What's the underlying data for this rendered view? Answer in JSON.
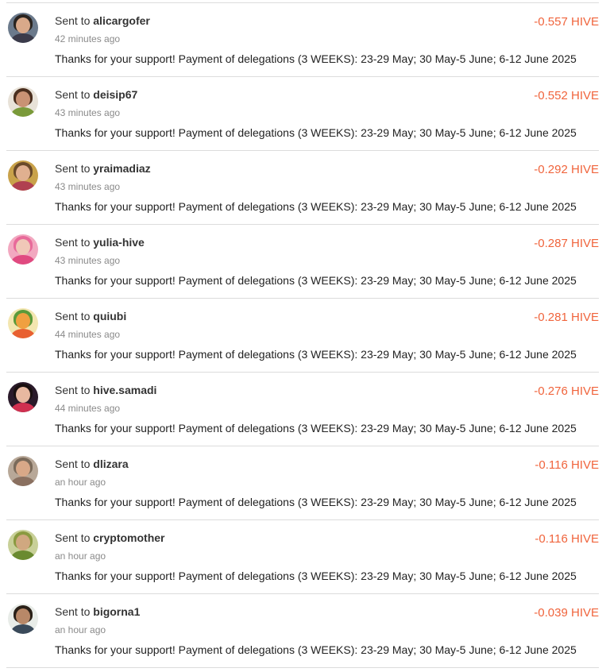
{
  "accent_color": "#f0643c",
  "transfers": [
    {
      "prefix": "Sent to ",
      "user": "alicargofer",
      "time": "42 minutes ago",
      "amount": "-0.557 HIVE",
      "memo": "Thanks for your support! Payment of delegations (3 WEEKS): 23-29 May; 30 May-5 June; 6-12 June 2025",
      "avatar_colors": {
        "bg": "#6b7a8c",
        "hair": "#2a2420",
        "face": "#d9a98a",
        "body": "#3b3b4a"
      }
    },
    {
      "prefix": "Sent to ",
      "user": "deisip67",
      "time": "43 minutes ago",
      "amount": "-0.552 HIVE",
      "memo": "Thanks for your support! Payment of delegations (3 WEEKS): 23-29 May; 30 May-5 June; 6-12 June 2025",
      "avatar_colors": {
        "bg": "#e8e2d8",
        "hair": "#4a2e1e",
        "face": "#c99274",
        "body": "#7a9a3a"
      }
    },
    {
      "prefix": "Sent to ",
      "user": "yraimadiaz",
      "time": "43 minutes ago",
      "amount": "-0.292 HIVE",
      "memo": "Thanks for your support! Payment of delegations (3 WEEKS): 23-29 May; 30 May-5 June; 6-12 June 2025",
      "avatar_colors": {
        "bg": "#c9a24a",
        "hair": "#6a4a2a",
        "face": "#e0b090",
        "body": "#b04050"
      }
    },
    {
      "prefix": "Sent to ",
      "user": "yulia-hive",
      "time": "43 minutes ago",
      "amount": "-0.287 HIVE",
      "memo": "Thanks for your support! Payment of delegations (3 WEEKS): 23-29 May; 30 May-5 June; 6-12 June 2025",
      "avatar_colors": {
        "bg": "#f2a8c0",
        "hair": "#e86a9a",
        "face": "#f0c8b8",
        "body": "#e04a80"
      }
    },
    {
      "prefix": "Sent to ",
      "user": "quiubi",
      "time": "44 minutes ago",
      "amount": "-0.281 HIVE",
      "memo": "Thanks for your support! Payment of delegations (3 WEEKS): 23-29 May; 30 May-5 June; 6-12 June 2025",
      "avatar_colors": {
        "bg": "#f3e6b0",
        "hair": "#5a9a3a",
        "face": "#f0a040",
        "body": "#e86030"
      }
    },
    {
      "prefix": "Sent to ",
      "user": "hive.samadi",
      "time": "44 minutes ago",
      "amount": "-0.276 HIVE",
      "memo": "Thanks for your support! Payment of delegations (3 WEEKS): 23-29 May; 30 May-5 June; 6-12 June 2025",
      "avatar_colors": {
        "bg": "#2a1a2a",
        "hair": "#1a1010",
        "face": "#e8b8a0",
        "body": "#d03050"
      }
    },
    {
      "prefix": "Sent to ",
      "user": "dlizara",
      "time": "an hour ago",
      "amount": "-0.116 HIVE",
      "memo": "Thanks for your support! Payment of delegations (3 WEEKS): 23-29 May; 30 May-5 June; 6-12 June 2025",
      "avatar_colors": {
        "bg": "#b8a898",
        "hair": "#7a6a5a",
        "face": "#d8a888",
        "body": "#8a7060"
      }
    },
    {
      "prefix": "Sent to ",
      "user": "cryptomother",
      "time": "an hour ago",
      "amount": "-0.116 HIVE",
      "memo": "Thanks for your support! Payment of delegations (3 WEEKS): 23-29 May; 30 May-5 June; 6-12 June 2025",
      "avatar_colors": {
        "bg": "#c8d098",
        "hair": "#8a9a40",
        "face": "#d0a880",
        "body": "#6a8a30"
      }
    },
    {
      "prefix": "Sent to ",
      "user": "bigorna1",
      "time": "an hour ago",
      "amount": "-0.039 HIVE",
      "memo": "Thanks for your support! Payment of delegations (3 WEEKS): 23-29 May; 30 May-5 June; 6-12 June 2025",
      "avatar_colors": {
        "bg": "#e8ece8",
        "hair": "#2a2018",
        "face": "#b88868",
        "body": "#3a4a5a"
      }
    }
  ]
}
